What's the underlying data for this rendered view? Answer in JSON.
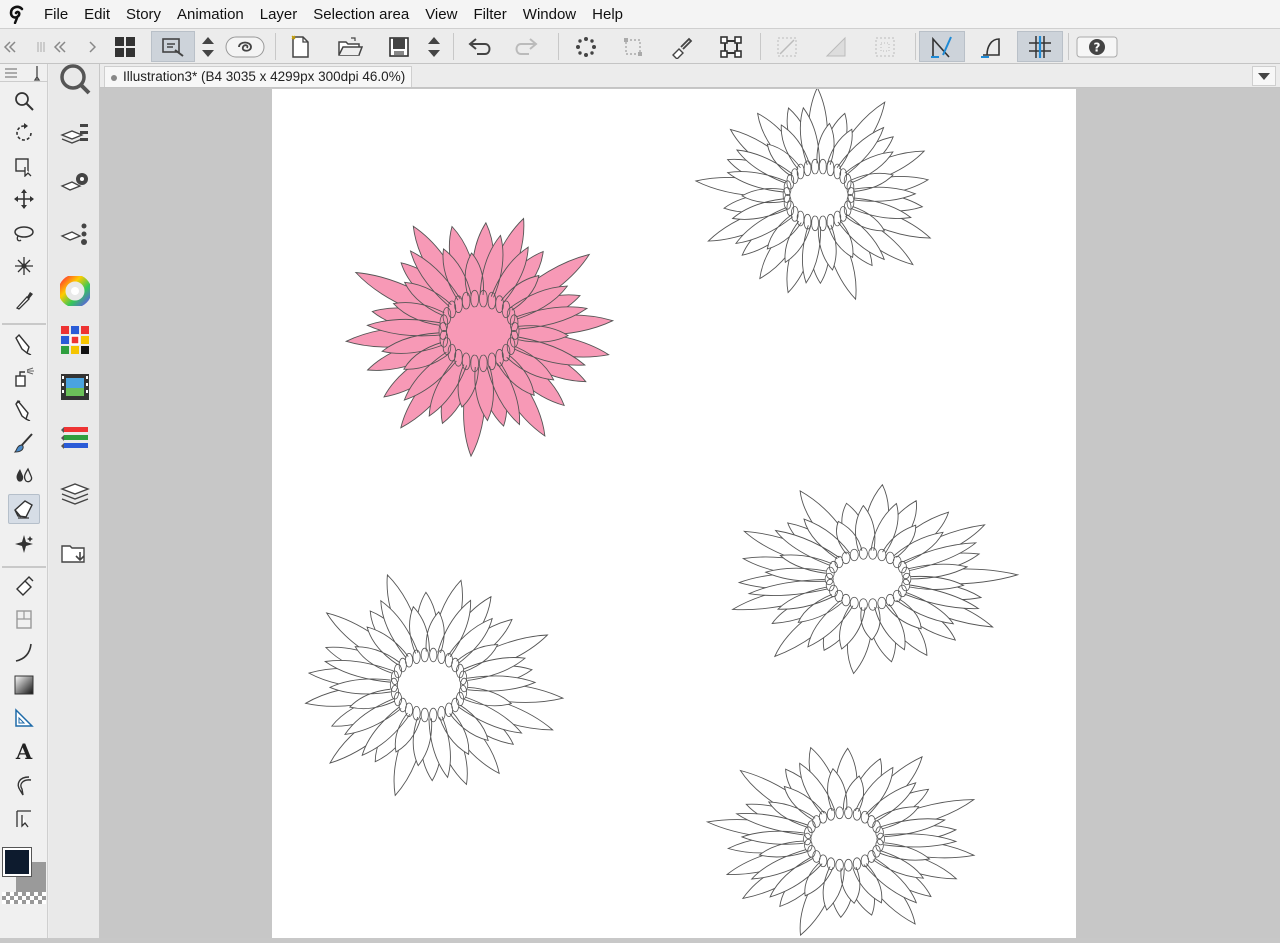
{
  "menu": {
    "items": [
      "File",
      "Edit",
      "Story",
      "Animation",
      "Layer",
      "Selection area",
      "View",
      "Filter",
      "Window",
      "Help"
    ]
  },
  "document": {
    "tab_title": "Illustration3* (B4 3035 x 4299px 300dpi 46.0%)"
  },
  "colors": {
    "main_color": "#0d1b2e",
    "sub_color": "#9a9a9a",
    "flower_fill": "#f799b6",
    "flower_stroke": "#555555"
  },
  "toolbar": {
    "icons": [
      "show-all-palettes-icon",
      "navigator-icon",
      "command-order-icon",
      "layer-link-icon",
      "new-file-icon",
      "open-file-icon",
      "save-icon",
      "save-order-icon",
      "undo-icon",
      "redo-icon",
      "selection-launcher-icon",
      "clear-outside-selection-icon",
      "fill-selection-icon",
      "transform-icon",
      "snap-ruler-icon",
      "snap-special-ruler-icon",
      "snap-grid-icon",
      "ruler-snap-icon",
      "special-ruler-snap-icon",
      "grid-snap-icon",
      "help-icon"
    ]
  },
  "tools": {
    "names": [
      "zoom-tool",
      "rotate-tool",
      "object-tool",
      "move-tool",
      "lasso-tool",
      "auto-select-tool",
      "eyedropper-tool",
      "pen-tool",
      "airbrush-tool",
      "pencil-tool",
      "brush-tool",
      "blend-tool",
      "eraser-tool",
      "decoration-tool",
      "fill-tool",
      "frame-tool",
      "figure-tool",
      "gradient-tool",
      "ruler-tool",
      "text-tool",
      "balloon-tool",
      "correct-line-tool"
    ]
  },
  "palettes": {
    "names": [
      "search-icon",
      "layer-property-icon",
      "tool-property-icon",
      "sub-tool-detail-icon",
      "color-wheel-icon",
      "color-set-icon",
      "animation-timeline-icon",
      "color-slider-icon",
      "layer-palette-icon",
      "material-icon"
    ]
  }
}
